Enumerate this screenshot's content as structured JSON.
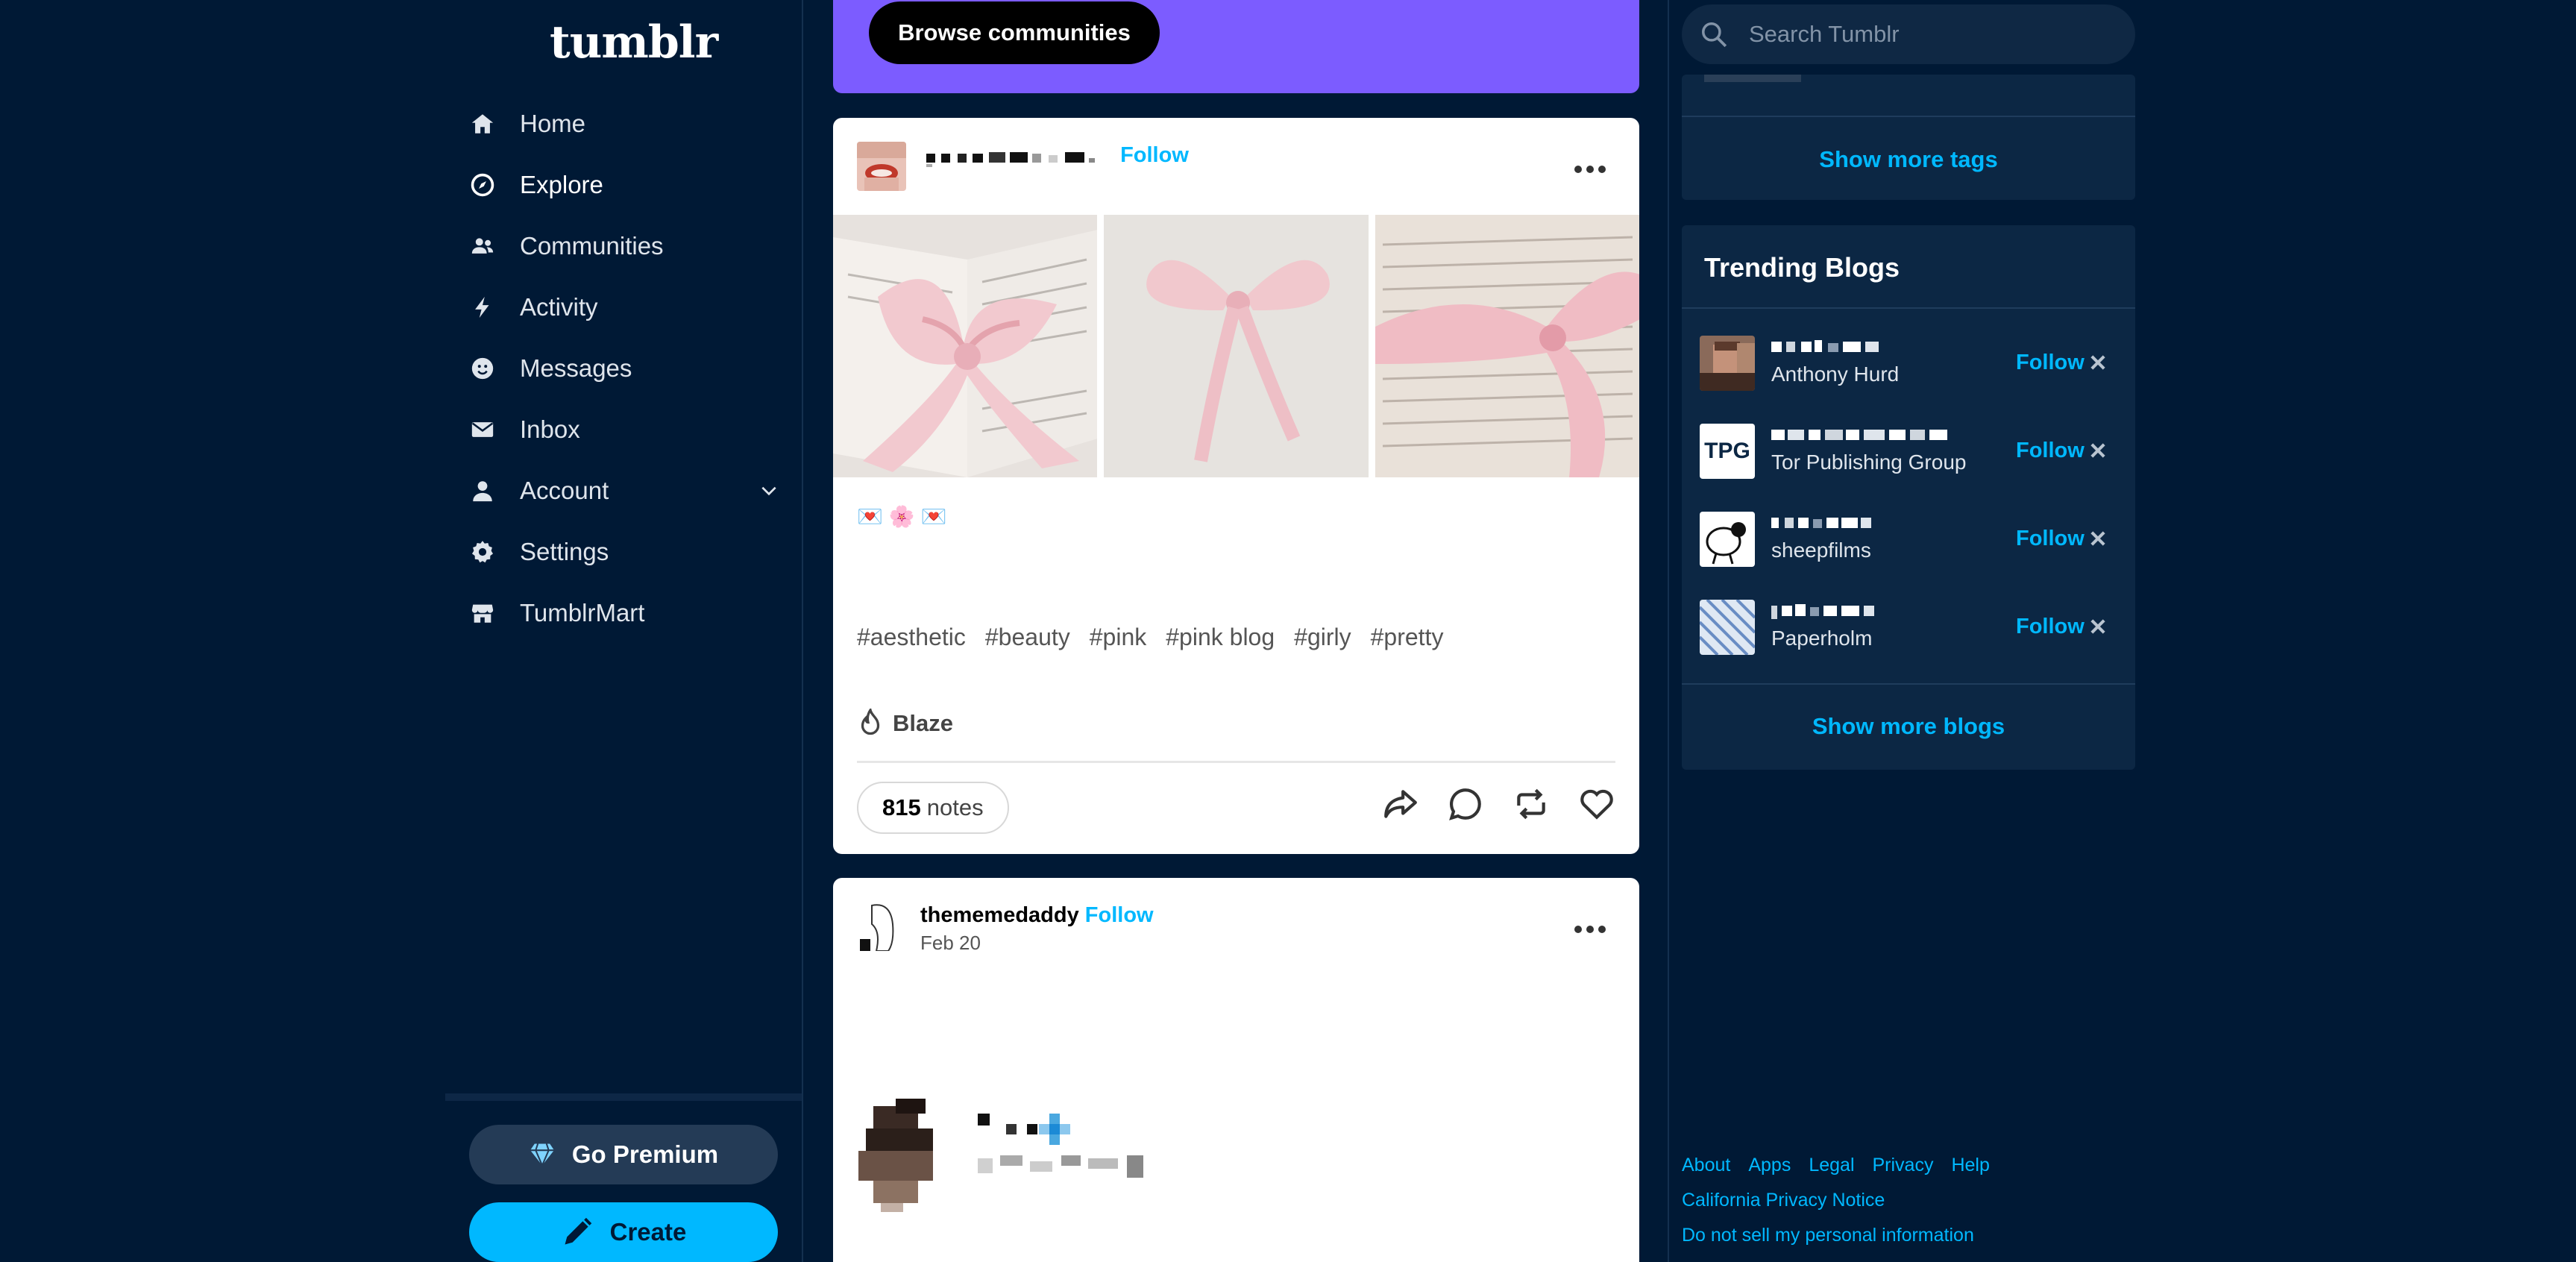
{
  "brand": {
    "logo_text": "tumblr"
  },
  "nav": {
    "items": [
      {
        "label": "Home",
        "icon": "home-icon"
      },
      {
        "label": "Explore",
        "icon": "compass-icon",
        "active": true
      },
      {
        "label": "Communities",
        "icon": "people-icon"
      },
      {
        "label": "Activity",
        "icon": "lightning-icon"
      },
      {
        "label": "Messages",
        "icon": "smiley-icon"
      },
      {
        "label": "Inbox",
        "icon": "envelope-icon"
      },
      {
        "label": "Account",
        "icon": "person-icon"
      },
      {
        "label": "Settings",
        "icon": "gear-icon"
      },
      {
        "label": "TumblrMart",
        "icon": "storefront-icon"
      }
    ]
  },
  "sidebar_bottom": {
    "premium_label": "Go Premium",
    "create_label": "Create"
  },
  "banner": {
    "browse_label": "Browse communities"
  },
  "post1": {
    "follow_label": "Follow",
    "emojis": [
      "💌",
      "🌸",
      "💌"
    ],
    "tags": [
      "#aesthetic",
      "#beauty",
      "#pink",
      "#pink blog",
      "#girly",
      "#pretty"
    ],
    "blaze_label": "Blaze",
    "notes_count": "815",
    "notes_label": "notes"
  },
  "post2": {
    "blog_name": "thememedaddy",
    "follow_label": "Follow",
    "date": "Feb 20"
  },
  "right": {
    "search_placeholder": "Search Tumblr",
    "show_more_tags": "Show more tags",
    "trending_title": "Trending Blogs",
    "blogs": [
      {
        "title": "Anthony Hurd",
        "follow": "Follow"
      },
      {
        "title": "Tor Publishing Group",
        "follow": "Follow",
        "avatar_text": "TPG"
      },
      {
        "title": "sheepfilms",
        "follow": "Follow"
      },
      {
        "title": "Paperholm",
        "follow": "Follow"
      }
    ],
    "show_more_blogs": "Show more blogs"
  },
  "footer": {
    "links": [
      "About",
      "Apps",
      "Legal",
      "Privacy",
      "Help"
    ],
    "california": "California Privacy Notice",
    "do_not_sell": "Do not sell my personal information"
  },
  "colors": {
    "background": "#001935",
    "accent": "#00b8ff",
    "banner": "#7c5cff",
    "panel": "#0c2744"
  }
}
